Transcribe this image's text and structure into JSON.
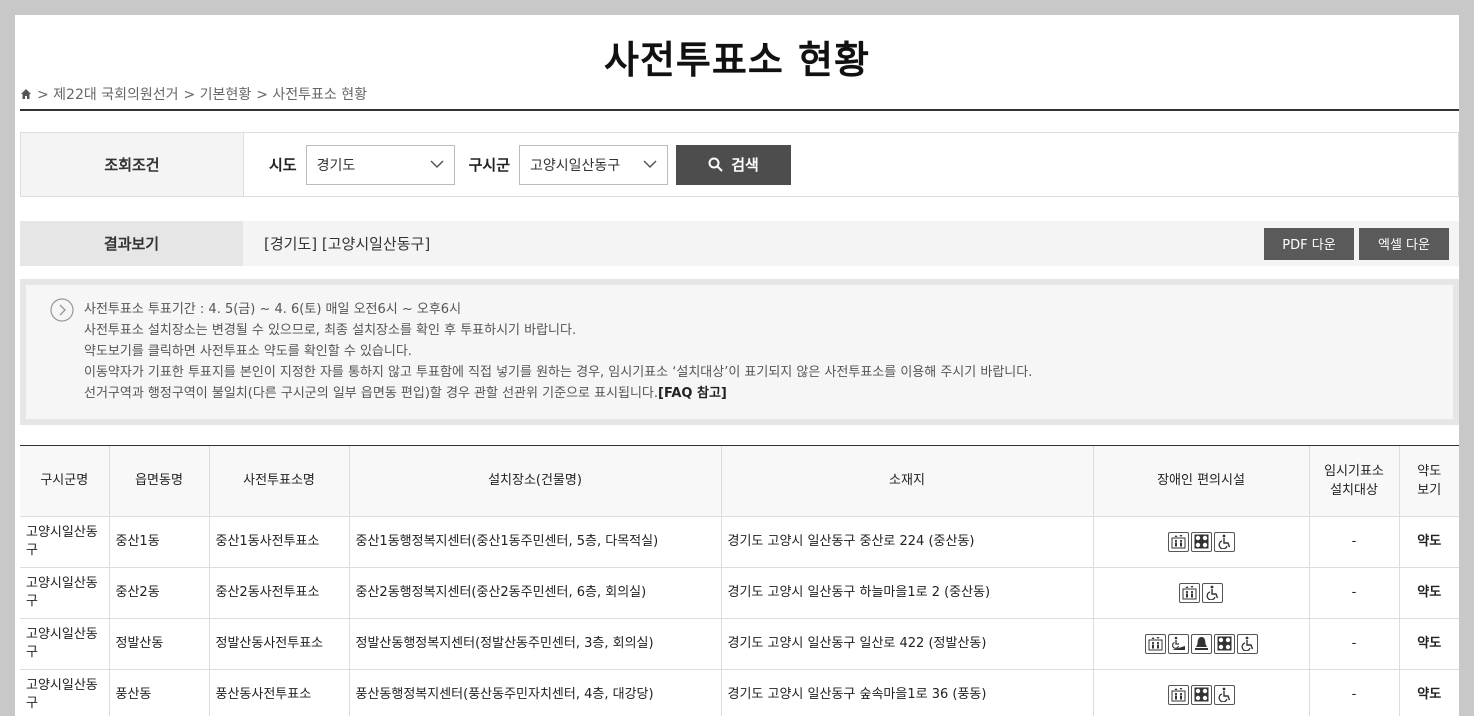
{
  "page": {
    "title": "사전투표소 현황"
  },
  "breadcrumb": [
    "> 제22대 국회의원선거",
    "> 기본현황",
    "> 사전투표소 현황"
  ],
  "search": {
    "label": "조회조건",
    "sido_label": "시도",
    "sido_value": "경기도",
    "gusigun_label": "구시군",
    "gusigun_value": "고양시일산동구",
    "button_label": "검색"
  },
  "result": {
    "label": "결과보기",
    "text": "[경기도] [고양시일산동구]",
    "pdf_button": "PDF 다운",
    "excel_button": "엑셀 다운"
  },
  "notice": {
    "lines": [
      "사전투표소 투표기간 : 4. 5(금) ~ 4. 6(토) 매일 오전6시 ~ 오후6시",
      "사전투표소 설치장소는 변경될 수 있으므로, 최종 설치장소를 확인 후 투표하시기 바랍니다.",
      "약도보기를 클릭하면 사전투표소 약도를 확인할 수 있습니다.",
      "이동약자가 기표한 투표지를 본인이 지정한 자를 통하지 않고 투표함에 직접 넣기를 원하는 경우, 임시기표소 ‘설치대상’이 표기되지 않은 사전투표소를 이용해 주시기 바랍니다.",
      "선거구역과 행정구역이 불일치(다른 구시군의 일부 읍면동 편입)할 경우 관할 선관위 기준으로 표시됩니다."
    ],
    "faq_link": "[FAQ 참고]"
  },
  "table": {
    "headers": {
      "gusigun": "구시군명",
      "eupmyeondong": "읍면동명",
      "station": "사전투표소명",
      "place": "설치장소(건물명)",
      "address": "소재지",
      "facilities": "장애인 편의시설",
      "temp_booth": [
        "임시기표소",
        "설치대상"
      ],
      "map": [
        "약도",
        "보기"
      ]
    },
    "rows": [
      {
        "gusigun": "고양시일산동구",
        "dong": "중산1동",
        "station": "중산1동사전투표소",
        "place": "중산1동행정복지센터(중산1동주민센터, 5층, 다목적실)",
        "address": "경기도 고양시 일산동구 중산로 224 (중산동)",
        "facilities": [
          "elevator-icon",
          "braille-block-icon",
          "wheelchair-icon"
        ],
        "temp": "-",
        "map": "약도"
      },
      {
        "gusigun": "고양시일산동구",
        "dong": "중산2동",
        "station": "중산2동사전투표소",
        "place": "중산2동행정복지센터(중산2동주민센터, 6층, 회의실)",
        "address": "경기도 고양시 일산동구 하늘마을1로 2 (중산동)",
        "facilities": [
          "elevator-icon",
          "wheelchair-icon"
        ],
        "temp": "-",
        "map": "약도"
      },
      {
        "gusigun": "고양시일산동구",
        "dong": "정발산동",
        "station": "정발산동사전투표소",
        "place": "정발산동행정복지센터(정발산동주민센터, 3층, 회의실)",
        "address": "경기도 고양시 일산동구 일산로 422 (정발산동)",
        "facilities": [
          "elevator-icon",
          "ramp-icon",
          "bell-icon",
          "braille-block-icon",
          "wheelchair-icon"
        ],
        "temp": "-",
        "map": "약도"
      },
      {
        "gusigun": "고양시일산동구",
        "dong": "풍산동",
        "station": "풍산동사전투표소",
        "place": "풍산동행정복지센터(풍산동주민자치센터, 4층, 대강당)",
        "address": "경기도 고양시 일산동구 숲속마을1로 36 (풍동)",
        "facilities": [
          "elevator-icon",
          "braille-block-icon",
          "wheelchair-icon"
        ],
        "temp": "-",
        "map": "약도"
      }
    ]
  }
}
